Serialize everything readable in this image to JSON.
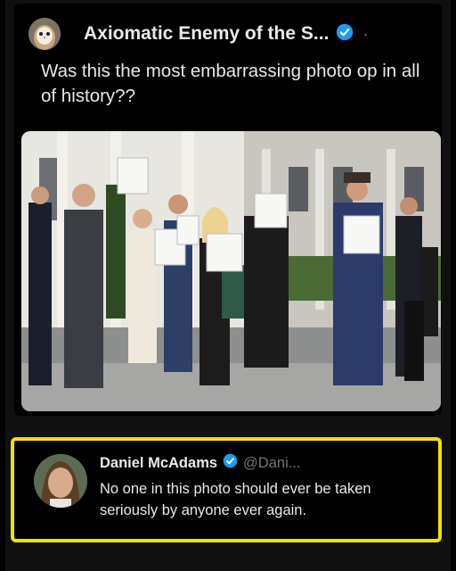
{
  "post": {
    "author_name": "Axiomatic Enemy of the S...",
    "separator": "·",
    "text": "Was this the most embarrassing photo op in all of history??",
    "verified_color": "#1d9bf0",
    "avatar_icon": "owl-avatar",
    "photo_icon": "group-photo"
  },
  "reply": {
    "author_name": "Daniel McAdams",
    "handle": "@Dani...",
    "text": "No one in this photo should ever be taken seriously by anyone ever again.",
    "highlight_color": "#f5e000"
  }
}
